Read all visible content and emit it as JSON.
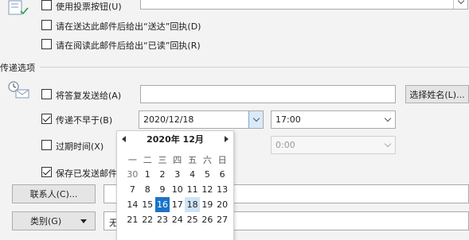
{
  "voting": {
    "use_voting_label": "使用投票按钮(U)",
    "delivery_receipt_label": "请在送达此邮件后给出“送达”回执(D)",
    "read_receipt_label": "请在阅读此邮件后给出“已读”回执(R)"
  },
  "delivery": {
    "section_title": "传递选项",
    "reply_to_label": "将答复发送给(A)",
    "reply_to_value": "",
    "select_names_button": "选择姓名(L)...",
    "no_before_label": "传递不早于(B)",
    "no_before_checked": true,
    "no_before_date": "2020/12/18",
    "no_before_time": "17:00",
    "expires_label": "过期时间(X)",
    "expires_checked": false,
    "expires_time": "0:00",
    "save_sent_label": "保存已发送邮件",
    "save_sent_checked": true
  },
  "contacts_button": "联系人(C)...",
  "categories_button": "类别(G)",
  "categories_value": "无",
  "calendar": {
    "header": "2020年 12月",
    "weekdays": [
      "一",
      "二",
      "三",
      "四",
      "五",
      "六",
      "日"
    ],
    "weeks": [
      [
        "30",
        "1",
        "2",
        "3",
        "4",
        "5",
        "6"
      ],
      [
        "7",
        "8",
        "9",
        "10",
        "11",
        "12",
        "13"
      ],
      [
        "14",
        "15",
        "16",
        "17",
        "18",
        "19",
        "20"
      ],
      [
        "21",
        "22",
        "23",
        "24",
        "25",
        "26",
        "27"
      ]
    ],
    "today": "16",
    "selected": "18",
    "dim_days": [
      "30"
    ]
  }
}
